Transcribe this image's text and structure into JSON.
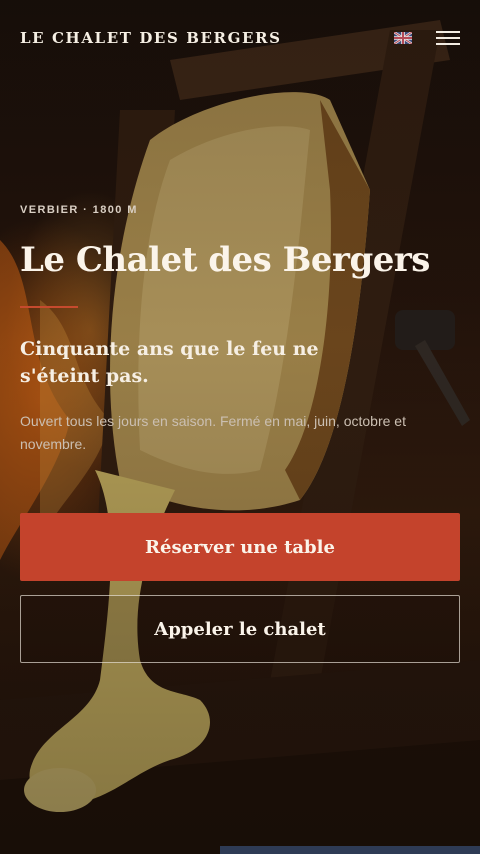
{
  "header": {
    "brand": "LE CHALET DES BERGERS",
    "language_icon": "uk-flag-icon",
    "menu_icon": "hamburger-menu-icon"
  },
  "hero": {
    "eyebrow": "VERBIER · 1800 M",
    "title": "Le Chalet des Bergers",
    "tagline": "Cinquante ans que le feu ne s'éteint pas.",
    "hours": "Ouvert tous les jours en saison. Fermé en mai, juin, octobre et novembre.",
    "image_subject": "raclette cheese wheel melting in front of a wood fire"
  },
  "actions": {
    "reserve_label": "Réserver une table",
    "call_label": "Appeler le chalet"
  },
  "colors": {
    "accent": "#c4432c",
    "text_light": "#fbf4ea",
    "background_dark": "#1a0f0a"
  }
}
